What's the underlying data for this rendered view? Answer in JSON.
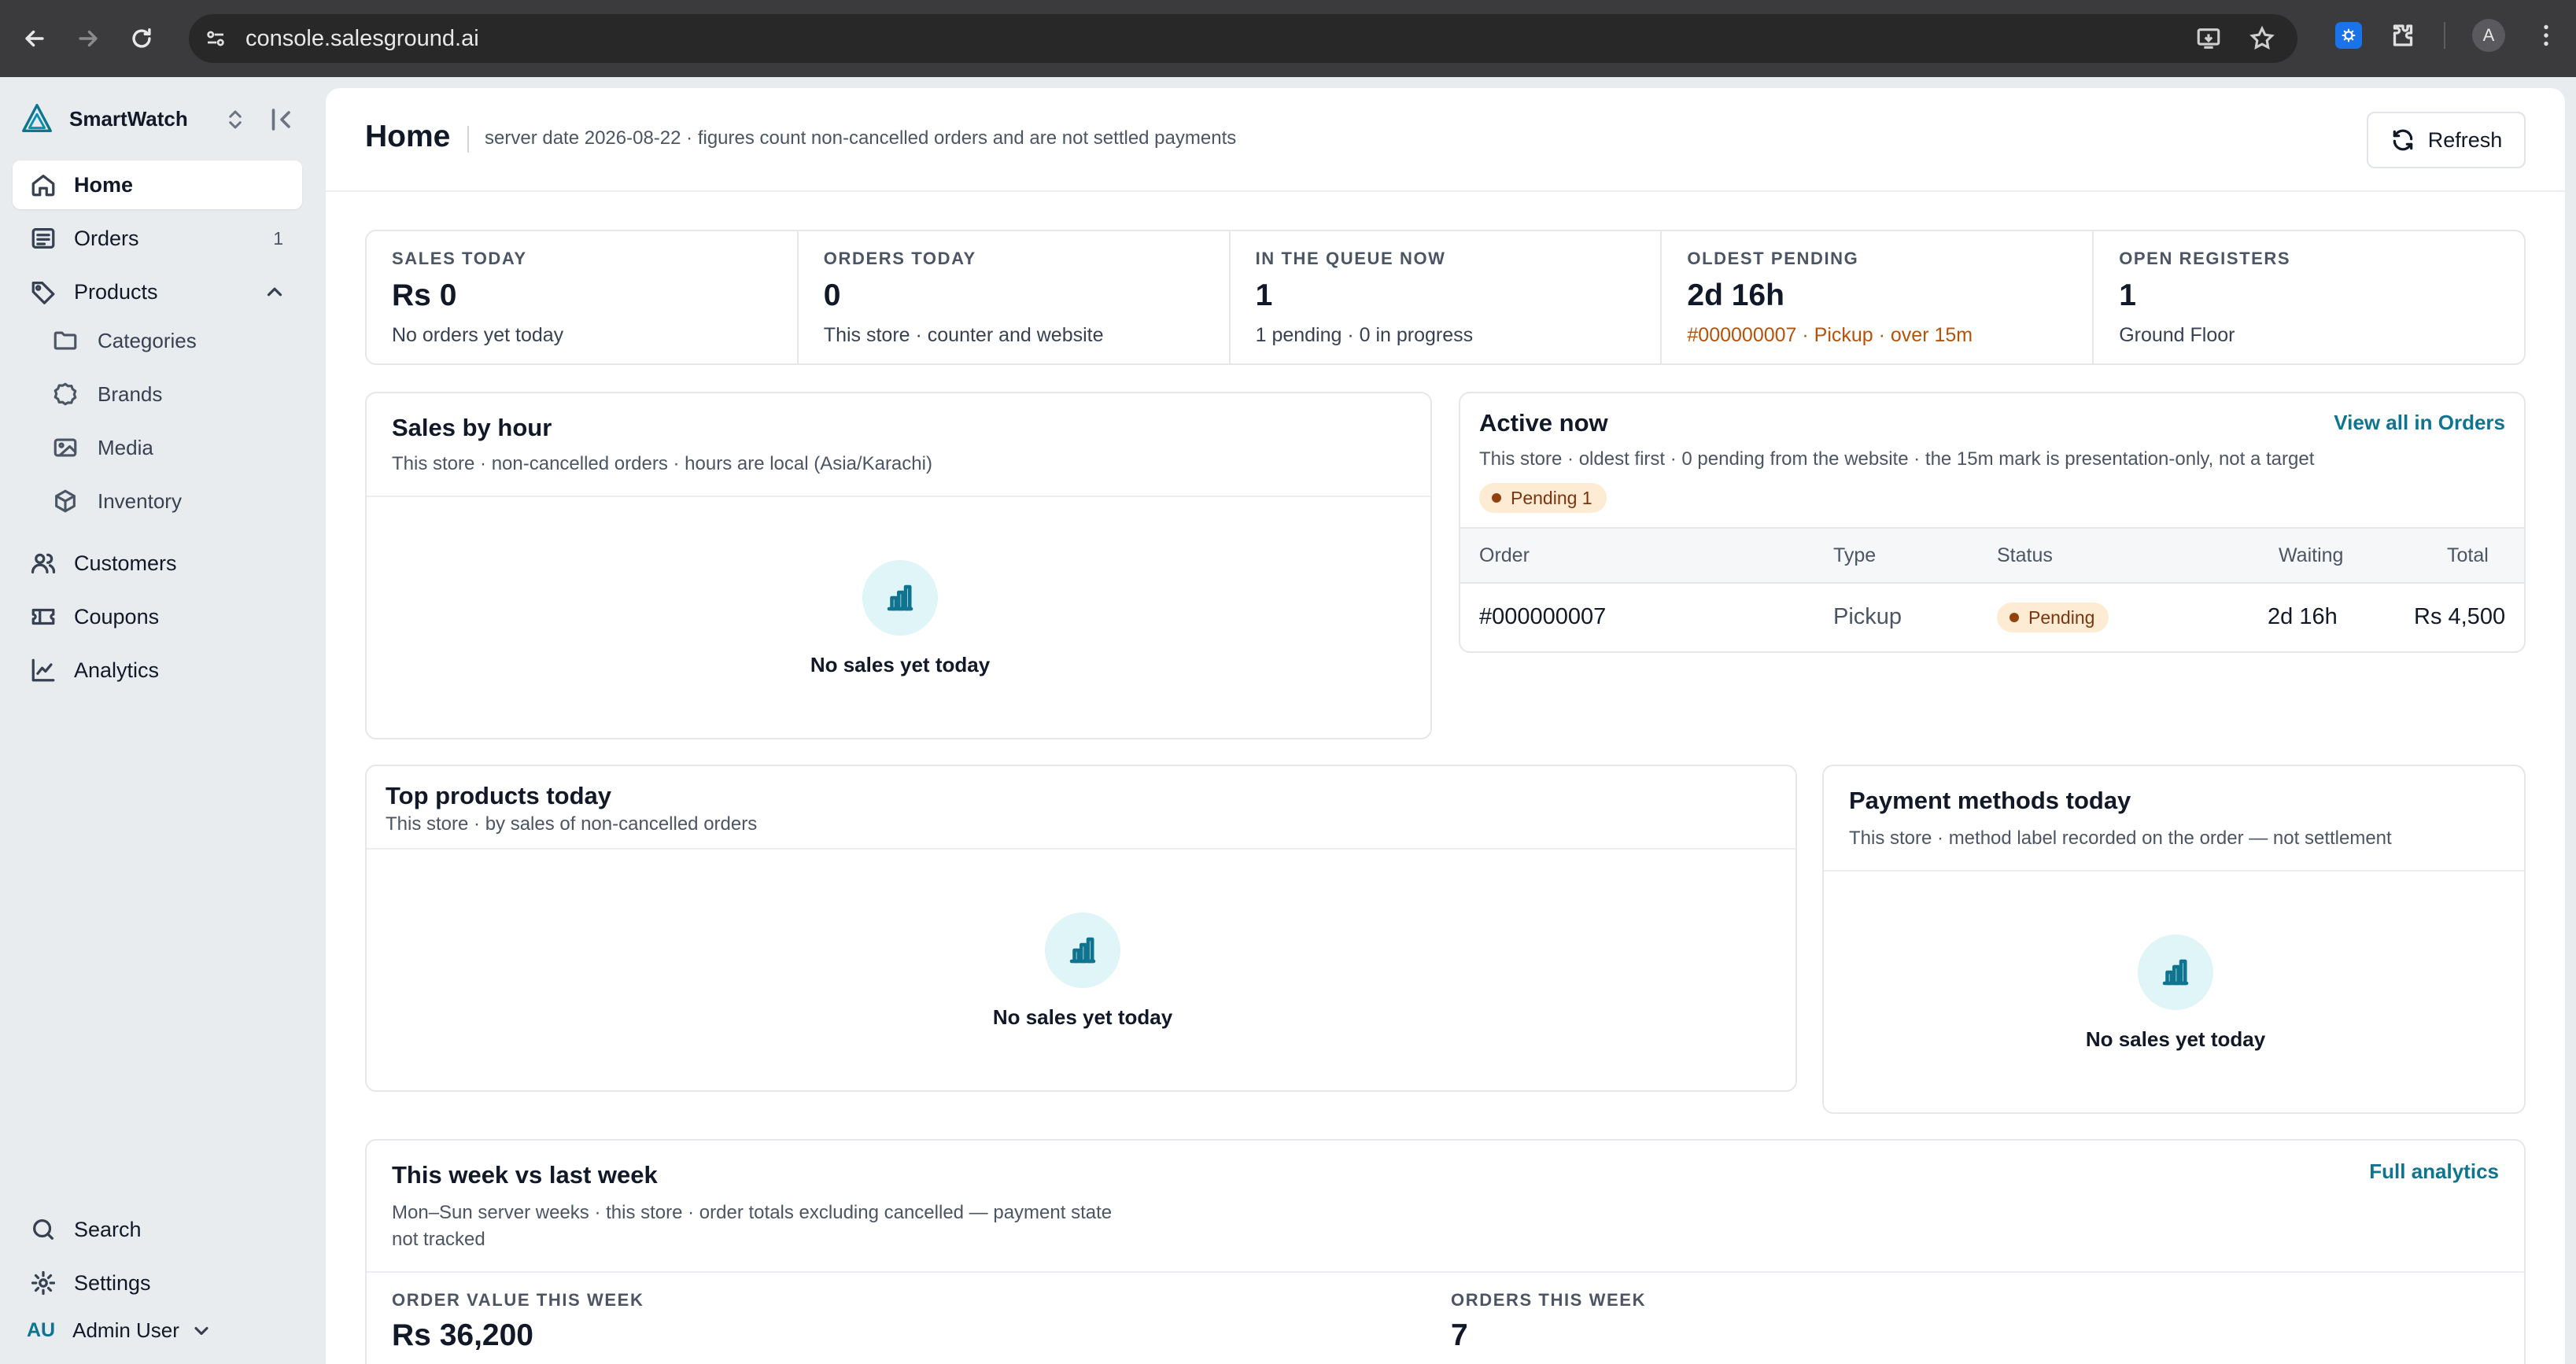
{
  "browser": {
    "url": "console.salesground.ai",
    "profile_initial": "A"
  },
  "sidebar": {
    "brand": "SmartWatch",
    "items": [
      {
        "label": "Home",
        "icon": "home-icon",
        "active": true
      },
      {
        "label": "Orders",
        "icon": "orders-icon",
        "count": "1"
      },
      {
        "label": "Products",
        "icon": "tag-icon",
        "expanded": true
      },
      {
        "label": "Customers",
        "icon": "users-icon"
      },
      {
        "label": "Coupons",
        "icon": "ticket-icon"
      },
      {
        "label": "Analytics",
        "icon": "chart-line-icon"
      }
    ],
    "sub_items": [
      {
        "label": "Categories",
        "icon": "folder-icon"
      },
      {
        "label": "Brands",
        "icon": "badge-icon"
      },
      {
        "label": "Media",
        "icon": "image-icon"
      },
      {
        "label": "Inventory",
        "icon": "box-icon"
      }
    ],
    "footer": {
      "search": "Search",
      "settings": "Settings",
      "user_initials": "AU",
      "user_name": "Admin User"
    }
  },
  "header": {
    "title": "Home",
    "subtitle": "server date 2026-08-22 · figures count non-cancelled orders and are not settled payments",
    "refresh_label": "Refresh"
  },
  "stats": [
    {
      "label": "SALES TODAY",
      "value": "Rs 0",
      "sub": "No orders yet today"
    },
    {
      "label": "ORDERS TODAY",
      "value": "0",
      "sub": "This store · counter and website"
    },
    {
      "label": "IN THE QUEUE NOW",
      "value": "1",
      "sub": "1 pending · 0 in progress"
    },
    {
      "label": "OLDEST PENDING",
      "value": "2d 16h",
      "sub": "#000000007 · Pickup · over 15m",
      "warn": true
    },
    {
      "label": "OPEN REGISTERS",
      "value": "1",
      "sub": "Ground Floor"
    }
  ],
  "sales_by_hour": {
    "title": "Sales by hour",
    "subtitle": "This store · non-cancelled orders · hours are local (Asia/Karachi)",
    "empty": "No sales yet today"
  },
  "active_now": {
    "title": "Active now",
    "link": "View all in Orders",
    "subtitle": "This store · oldest first · 0 pending from the website · the 15m mark is presentation-only, not a target",
    "badge": "Pending 1",
    "columns": [
      "Order",
      "Type",
      "Status",
      "Waiting",
      "Total"
    ],
    "rows": [
      {
        "order": "#000000007",
        "type": "Pickup",
        "status": "Pending",
        "waiting": "2d 16h",
        "total": "Rs 4,500"
      }
    ]
  },
  "top_products": {
    "title": "Top products today",
    "subtitle": "This store · by sales of non-cancelled orders",
    "empty": "No sales yet today"
  },
  "payment_methods": {
    "title": "Payment methods today",
    "subtitle": "This store · method label recorded on the order — not settlement",
    "empty": "No sales yet today"
  },
  "week_compare": {
    "title": "This week vs last week",
    "link": "Full analytics",
    "subtitle_line1": "Mon–Sun server weeks · this store · order totals excluding cancelled — payment state",
    "subtitle_line2": "not tracked",
    "metrics": [
      {
        "label": "ORDER VALUE THIS WEEK",
        "value": "Rs 36,200"
      },
      {
        "label": "ORDERS THIS WEEK",
        "value": "7"
      }
    ]
  },
  "colors": {
    "accent": "#0e7490",
    "warning": "#b45309",
    "badge_bg": "#fdecd3"
  }
}
